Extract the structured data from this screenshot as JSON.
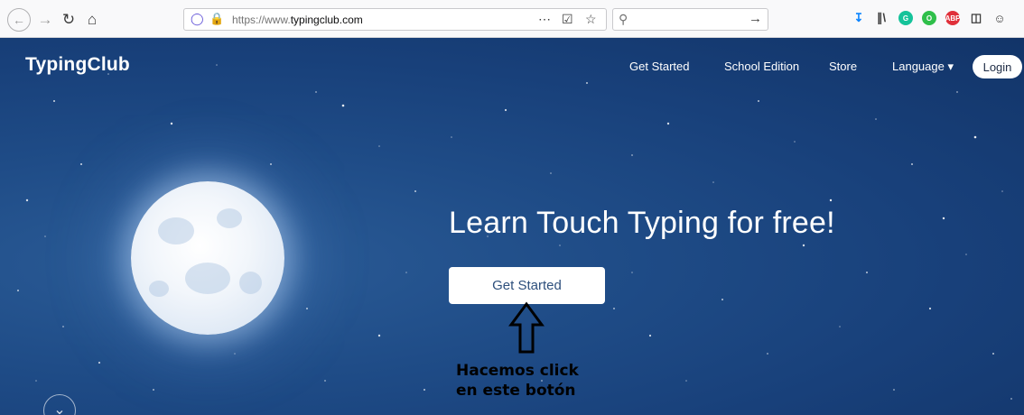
{
  "browser": {
    "url_prefix": "https://www.",
    "url_host": "typingclub",
    "url_suffix": ".com",
    "search_placeholder": ""
  },
  "site": {
    "logo": "TypingClub",
    "nav": [
      {
        "label": "Get Started"
      },
      {
        "label": "School Edition"
      },
      {
        "label": "Store"
      },
      {
        "label": "Language ▾"
      }
    ],
    "login_label": "Login"
  },
  "hero": {
    "title": "Learn Touch Typing for free!",
    "cta_label": "Get Started"
  },
  "annotation": {
    "line1": "Hacemos click",
    "line2": "en este botón"
  },
  "colors": {
    "background": "#1f4c87",
    "accent_text": "#2d4f7c"
  }
}
